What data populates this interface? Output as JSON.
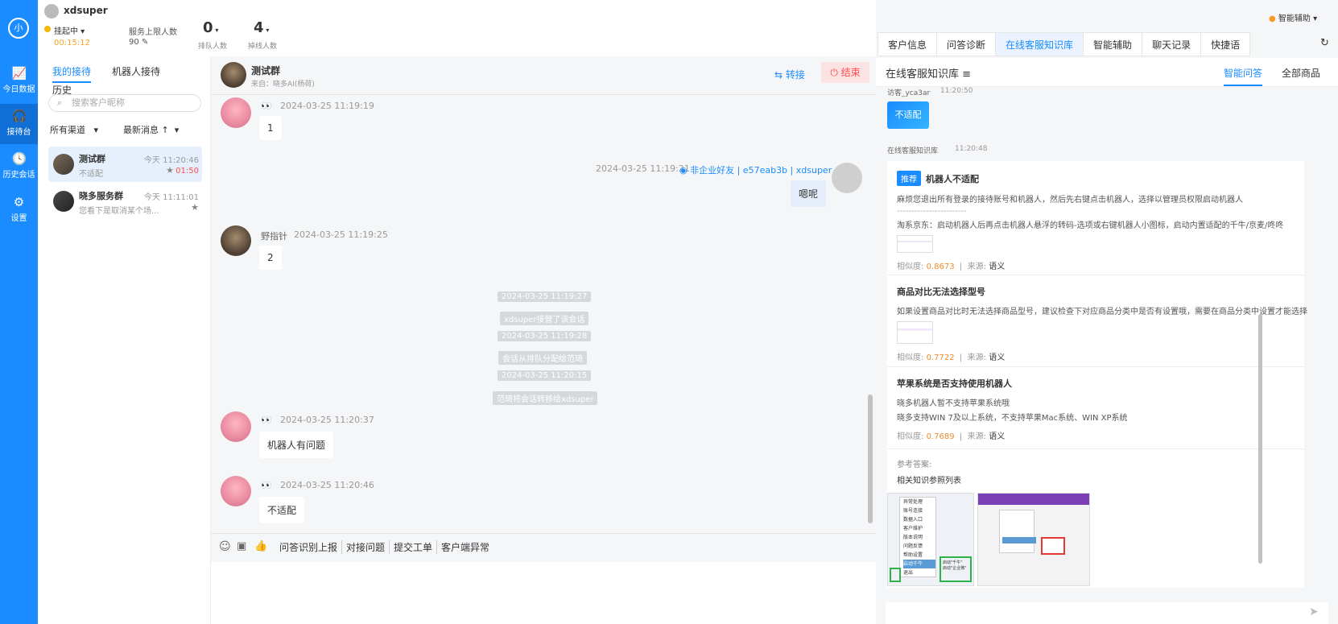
{
  "nav": {
    "logo": "小",
    "items": [
      {
        "label": "今日数据",
        "icon": "chart-icon"
      },
      {
        "label": "接待台",
        "icon": "headset-icon"
      },
      {
        "label": "历史会话",
        "icon": "clock-icon"
      },
      {
        "label": "设置",
        "icon": "gear-icon"
      }
    ]
  },
  "header": {
    "username": "xdsuper",
    "status": "挂起中",
    "timer": "00:15:12",
    "service_limit_label": "服务上限人数",
    "service_limit_value": "90",
    "queue_count": "0",
    "queue_label": "排队人数",
    "offline_count": "4",
    "offline_label": "掉线人数",
    "assist": "智能辅助"
  },
  "convlist": {
    "tabs": [
      "我的接待",
      "机器人接待",
      "历史"
    ],
    "search_placeholder": "搜索客户昵称",
    "filter_channel": "所有渠道",
    "filter_sort": "最新消息",
    "conversations": [
      {
        "name": "测试群",
        "preview": "不适配",
        "time": "今天 11:20:46",
        "timer": "01:50"
      },
      {
        "name": "晓多服务群",
        "preview": "您看下是取消某个场...",
        "time": "今天 11:11:01",
        "timer": ""
      }
    ]
  },
  "chat": {
    "title": "测试群",
    "source": "来自：晓多AI(杨荷)",
    "transfer": "转接",
    "end": "结束",
    "messages": [
      {
        "sender": "👀",
        "time": "2024-03-25 11:19:19",
        "text": "1"
      },
      {
        "meta": "2024-03-25 11:19:21",
        "badge": "非企业好友 | e57eab3b | xdsuper",
        "text": "嗯呢"
      },
      {
        "sender": "野指针",
        "time": "2024-03-25 11:19:25",
        "text": "2"
      },
      {
        "sender": "👀",
        "time": "2024-03-25 11:20:37",
        "text": "机器人有问题"
      },
      {
        "sender": "👀",
        "time": "2024-03-25 11:20:46",
        "text": "不适配"
      }
    ],
    "system": [
      "2024-03-25 11:19:27",
      "xdsuper接管了该会话",
      "2024-03-25 11:19:28",
      "会话从排队分配给范琦",
      "2024-03-25 11:20:15",
      "范琦将会话转移给xdsuper"
    ],
    "quick": [
      "问答识别上报",
      "对接问题",
      "提交工单",
      "客户端异常",
      "T"
    ]
  },
  "rpanel": {
    "tabs": [
      "客户信息",
      "问答诊断",
      "在线客服知识库",
      "智能辅助",
      "聊天记录",
      "快捷语"
    ],
    "kb_title": "在线客服知识库",
    "sub_tabs": [
      "智能问答",
      "全部商品"
    ],
    "prev_sender": "访客_yca3ar",
    "prev_time": "11:20:50",
    "prev_reply": "不适配",
    "kb_sender": "在线客服知识库",
    "kb_time": "11:20:48",
    "items": [
      {
        "tag": "推荐",
        "title": "机器人不适配",
        "lines": [
          "麻烦您退出所有登录的接待账号和机器人，然后先右键点击机器人，选择以管理员权限启动机器人",
          "------------------------",
          "淘系京东：启动机器人后再点击机器人悬浮的转码-选项或右键机器人小图标，启动内置适配的千牛/京麦/咚咚"
        ],
        "score": "0.8673",
        "source": "语义"
      },
      {
        "tag": "",
        "title": "商品对比无法选择型号",
        "lines": [
          "如果设置商品对比时无法选择商品型号，建议检查下对应商品分类中是否有设置哦，需要在商品分类中设置才能选择"
        ],
        "score": "0.7722",
        "source": "语义"
      },
      {
        "tag": "",
        "title": "苹果系统是否支持使用机器人",
        "lines": [
          "晓多机器人暂不支持苹果系统哦",
          "晓多支持WIN 7及以上系统，不支持苹果Mac系统、WIN XP系统"
        ],
        "score": "0.7689",
        "source": "语义"
      }
    ],
    "ref_label": "参考答案:",
    "ref_text": "相关知识参照列表",
    "score_label": "相似度:",
    "source_label": "来源:",
    "menu_labels": [
      "异常处理",
      "账号连接",
      "数据入口",
      "客户维护",
      "版本说明",
      "问题反馈",
      "帮助设置",
      "启动千牛",
      "退出"
    ],
    "callout_labels": [
      "启动\"千牛\"",
      "启动\"企业微\""
    ]
  }
}
